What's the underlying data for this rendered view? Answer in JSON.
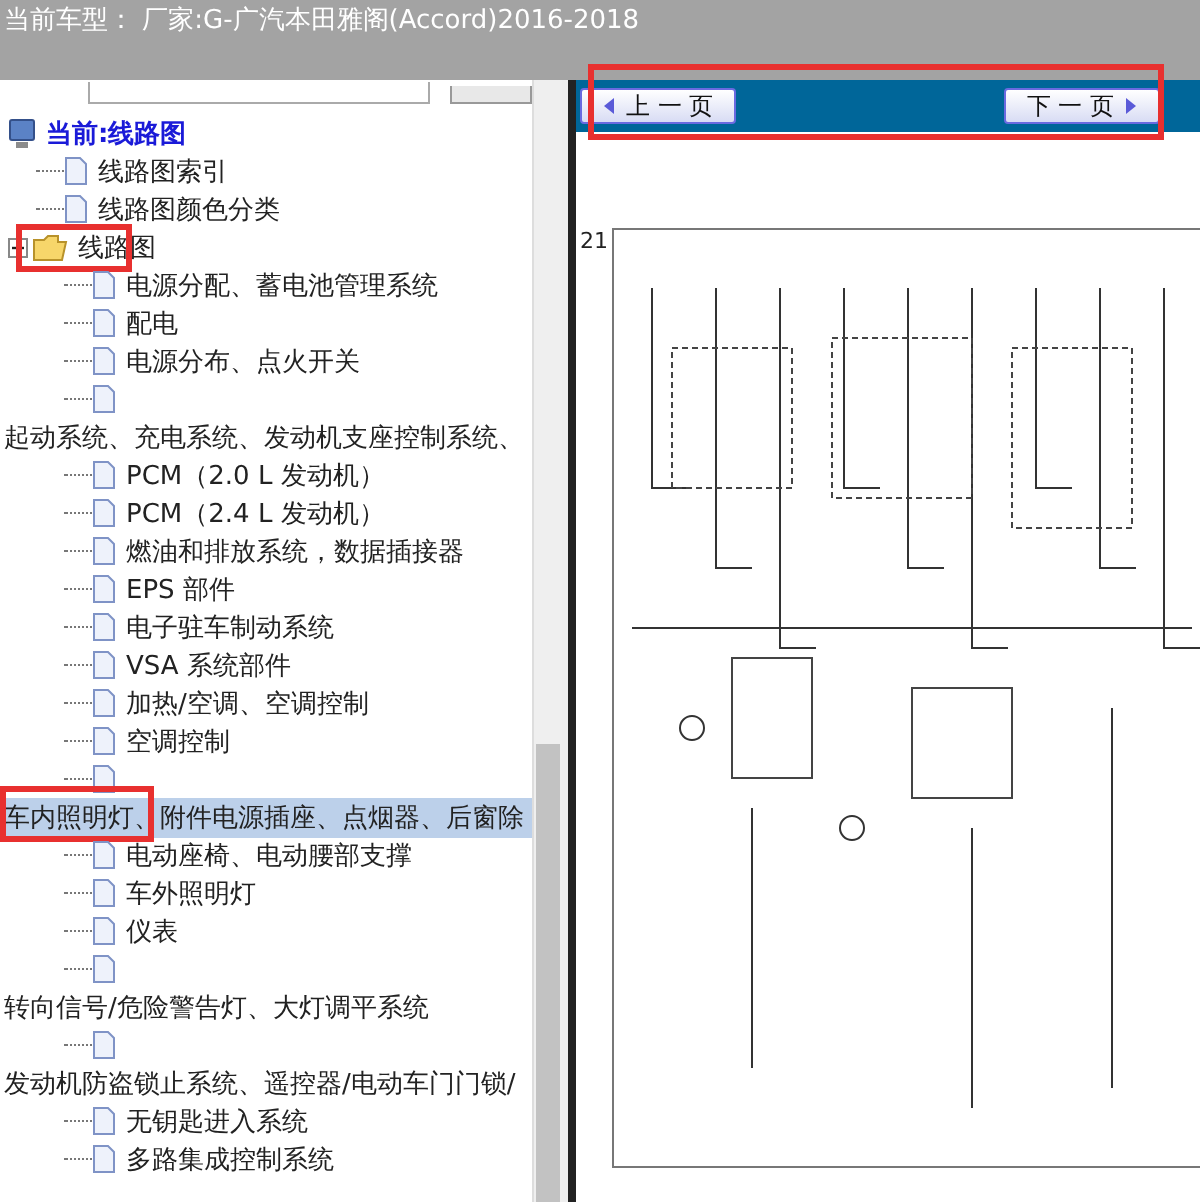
{
  "header": {
    "title": "当前车型： 厂家:G-广汽本田雅阁(Accord)2016-2018"
  },
  "tree": {
    "label": "当前:线路图",
    "kind": "root",
    "children": [
      {
        "label": "线路图索引",
        "kind": "doc"
      },
      {
        "label": "线路图颜色分类",
        "kind": "doc"
      },
      {
        "label": "线路图",
        "kind": "folder",
        "expanded": true,
        "marked": true,
        "children": [
          {
            "label": "电源分配、蓄电池管理系统",
            "kind": "doc"
          },
          {
            "label": "配电",
            "kind": "doc"
          },
          {
            "label": "电源分布、点火开关",
            "kind": "doc"
          },
          {
            "kind": "doc"
          },
          {
            "label": "起动系统、充电系统、发动机支座控制系统、",
            "kind": "heading",
            "selected": false,
            "marked": false
          },
          {
            "label": "PCM（2.0 L 发动机）",
            "kind": "doc"
          },
          {
            "label": "PCM（2.4 L 发动机）",
            "kind": "doc"
          },
          {
            "label": "燃油和排放系统，数据插接器",
            "kind": "doc"
          },
          {
            "label": "EPS 部件",
            "kind": "doc"
          },
          {
            "label": "电子驻车制动系统",
            "kind": "doc"
          },
          {
            "label": "VSA 系统部件",
            "kind": "doc"
          },
          {
            "label": "加热/空调、空调控制",
            "kind": "doc"
          },
          {
            "label": "空调控制",
            "kind": "doc"
          },
          {
            "kind": "doc"
          },
          {
            "label": "车内照明灯、附件电源插座、点烟器、后窗除",
            "kind": "heading",
            "selected": true,
            "marked": true
          },
          {
            "label": "电动座椅、电动腰部支撑",
            "kind": "doc"
          },
          {
            "label": "车外照明灯",
            "kind": "doc"
          },
          {
            "label": "仪表",
            "kind": "doc"
          },
          {
            "kind": "doc"
          },
          {
            "label": "转向信号/危险警告灯、大灯调平系统",
            "kind": "heading",
            "selected": false,
            "marked": false
          },
          {
            "kind": "doc"
          },
          {
            "label": "发动机防盗锁止系统、遥控器/电动车门门锁/",
            "kind": "heading",
            "selected": false,
            "marked": false
          },
          {
            "label": "无钥匙进入系统",
            "kind": "doc"
          },
          {
            "label": "多路集成控制系统",
            "kind": "doc"
          }
        ]
      }
    ]
  },
  "toolbar": {
    "marked": true,
    "prev": "上 一 页",
    "next": "下 一 页"
  },
  "page": {
    "number": "21"
  }
}
